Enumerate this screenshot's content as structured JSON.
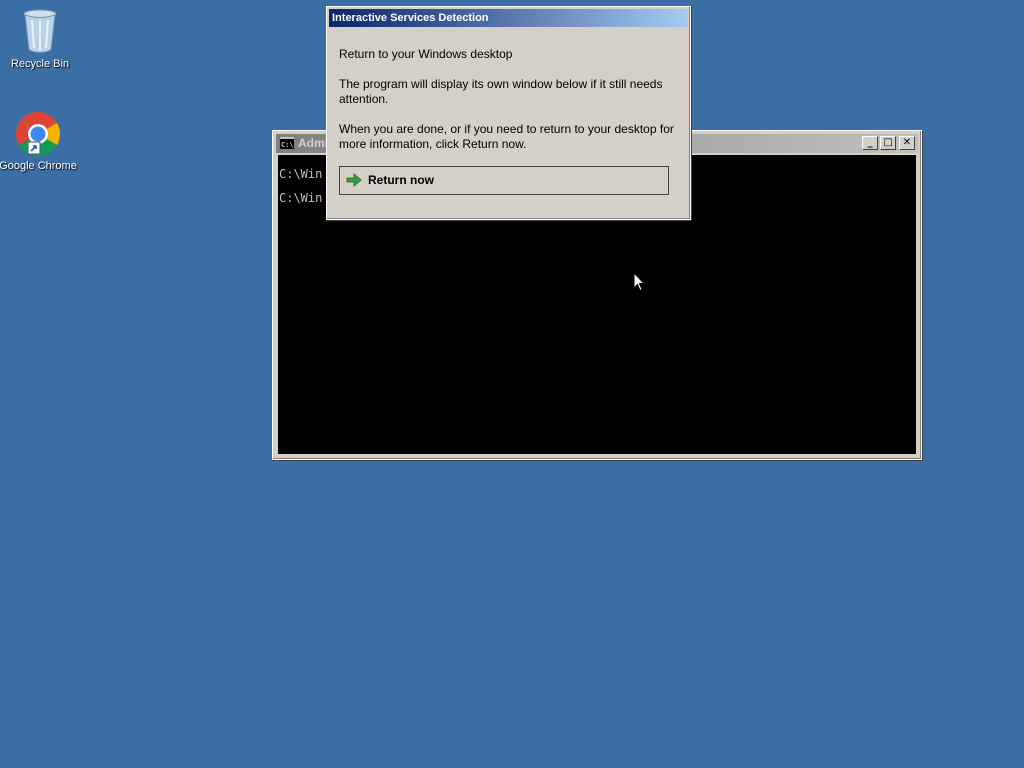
{
  "desktop": {
    "icons": [
      {
        "label": "Recycle Bin",
        "icon": "recycle-bin-icon"
      },
      {
        "label": "Google Chrome",
        "icon": "chrome-icon"
      }
    ],
    "background_color": "#3a6ea5"
  },
  "console": {
    "title": "Administrator: C:\\Windows\\system32\\cmd.exe",
    "lines": [
      "C:\\Win",
      "C:\\Win"
    ],
    "buttons": {
      "minimize": "_",
      "maximize": "□",
      "close": "✕"
    }
  },
  "dialog": {
    "title": "Interactive Services Detection",
    "heading": "Return to your Windows desktop",
    "paragraph1": "The program will display its own window below if it still needs attention.",
    "paragraph2": "When you are done, or if you need to return to your desktop for more information, click Return now.",
    "return_button": "Return now",
    "accent_color": "#0a246a"
  }
}
